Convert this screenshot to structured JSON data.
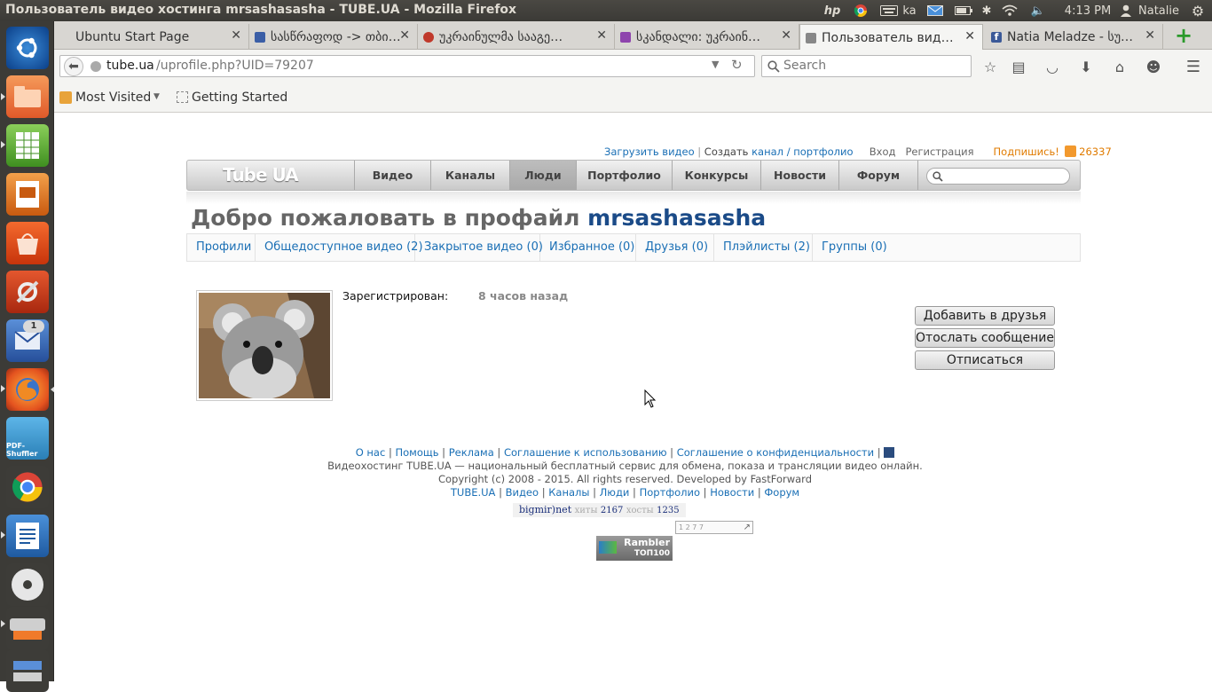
{
  "system": {
    "window_title": "Пользователь видео хостинга mrsashasasha - TUBE.UA - Mozilla Firefox",
    "keyboard_layout": "ka",
    "clock": "4:13 PM",
    "user_name": "Natalie",
    "launcher_badge": "1",
    "pdf_label": "PDF-Shuffler"
  },
  "browser": {
    "tabs": [
      {
        "label": "Ubuntu Start Page",
        "fav_color": "#dd4814"
      },
      {
        "label": "სასწრაფოდ -> თბი…",
        "fav_color": "#3b5ea6"
      },
      {
        "label": "უკრაინულმა სააგე…",
        "fav_color": "#c0392b"
      },
      {
        "label": "სკანდალი: უკრაინ…",
        "fav_color": "#8e44ad"
      },
      {
        "label": "Пользователь вид…",
        "fav_color": "#888888"
      },
      {
        "label": "Natia Meladze - სუ…",
        "fav_color": "#3b5998"
      }
    ],
    "url_host": "tube.ua",
    "url_path": "/uprofile.php?UID=79207",
    "search_placeholder": "Search",
    "bookmarks": {
      "most_visited": "Most Visited",
      "getting_started": "Getting Started"
    }
  },
  "site": {
    "top_links": {
      "upload": "Загрузить видео",
      "create_prefix": "Создать",
      "channel": "канал",
      "sep": "/",
      "portfolio": "портфолио",
      "login": "Вход",
      "register": "Регистрация",
      "subscribe": "Подпишись!",
      "subscribers": "26337"
    },
    "logo": "Tube UA",
    "nav": [
      "Видео",
      "Каналы",
      "Люди",
      "Портфолио",
      "Конкурсы",
      "Новости",
      "Форум"
    ],
    "headline_prefix": "Добро пожаловать в профайл",
    "username": "mrsashasasha",
    "profile_tabs": [
      "Профили",
      "Общедоступное видео (2)",
      "Закрытое видео (0)",
      "Избранное (0)",
      "Друзья (0)",
      "Плэйлисты (2)",
      "Группы (0)"
    ],
    "registered_label": "Зарегистрирован:",
    "registered_value": "8 часов назад",
    "buttons": {
      "add_friend": "Добавить в друзья",
      "send_message": "Отослать сообщение",
      "unsubscribe": "Отписаться"
    },
    "footer": {
      "links": [
        "О нас",
        "Помощь",
        "Реклама",
        "Соглашение к использованию",
        "Соглашение о конфиденциальности"
      ],
      "description": "Видеохостинг TUBE.UA — национальный бесплатный сервис для обмена, показа и трансляции видео онлайн.",
      "copyright": "Copyright (c) 2008 - 2015. All rights reserved. Developed by FastForward",
      "nav_links": [
        "TUBE.UA",
        "Видео",
        "Каналы",
        "Люди",
        "Портфолио",
        "Новости",
        "Форум"
      ],
      "counter_brand": "bigmir)net",
      "hits_label": "хиты",
      "hits": "2167",
      "hosts_label": "хосты",
      "hosts": "1235",
      "small_counter": "1 2 7 7",
      "rambler_1": "Rambler",
      "rambler_2": "ТОП100"
    }
  }
}
